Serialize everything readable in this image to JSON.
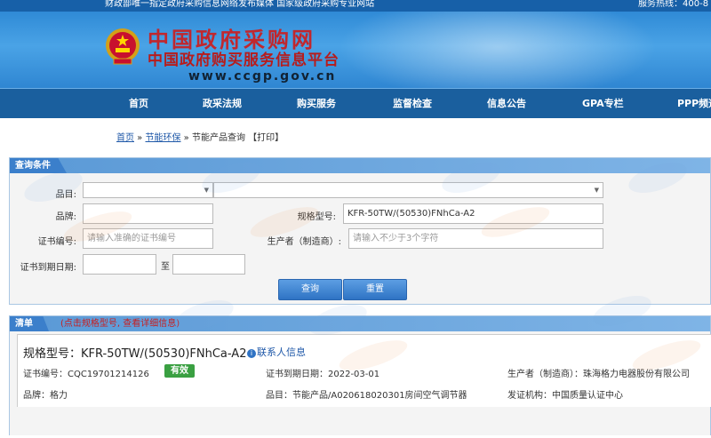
{
  "topbar": {
    "left_text": "财政部唯一指定政府采购信息网络发布媒体 国家级政府采购专业网站",
    "right_text": "服务热线：400-8"
  },
  "header": {
    "title_cn": "中国政府采购网",
    "subtitle": "中国政府购买服务信息平台",
    "url": "www.ccgp.gov.cn"
  },
  "nav": {
    "items": [
      {
        "label": "首页"
      },
      {
        "label": "政采法规"
      },
      {
        "label": "购买服务"
      },
      {
        "label": "监督检查"
      },
      {
        "label": "信息公告"
      },
      {
        "label": "GPA专栏"
      },
      {
        "label": "PPP频道"
      }
    ]
  },
  "breadcrumb": {
    "home": "首页",
    "sep1": " » ",
    "section": "节能环保",
    "sep2": " » ",
    "current": "节能产品查询",
    "print": "【打印】"
  },
  "query": {
    "header": "查询条件",
    "category_label": "品目:",
    "category_value": "",
    "category_sub_value": "",
    "brand_label": "品牌:",
    "brand_value": "",
    "model_label": "规格型号:",
    "model_value": "KFR-50TW/(50530)FNhCa-A2",
    "cert_label": "证书编号:",
    "cert_placeholder": "请输入准确的证书编号",
    "producer_label": "生产者（制造商）:",
    "producer_placeholder": "请输入不少于3个字符",
    "expiry_label": "证书到期日期:",
    "expiry_to": "至",
    "expiry_from_value": "",
    "expiry_to_value": "",
    "search_button": "查询",
    "reset_button": "重置"
  },
  "results": {
    "header": "清单",
    "hint": "(点击规格型号, 查看详细信息)",
    "item": {
      "title": "规格型号：KFR-50TW/(50530)FNhCa-A2",
      "contact": "联系人信息",
      "cert_no": "证书编号：CQC19701214126",
      "status": "有效",
      "expiry": "证书到期日期：2022-03-01",
      "producer": "生产者（制造商）：珠海格力电器股份有限公司",
      "brand": "品牌：格力",
      "category": "品目：节能产品/A020618020301房间空气调节器",
      "issuer": "发证机构：中国质量认证中心"
    }
  },
  "colors": {
    "nav_bg": "#1a5f9e",
    "panel_head": "#5a99d6",
    "status_green": "#3aa042",
    "title_red": "#c1272d"
  }
}
